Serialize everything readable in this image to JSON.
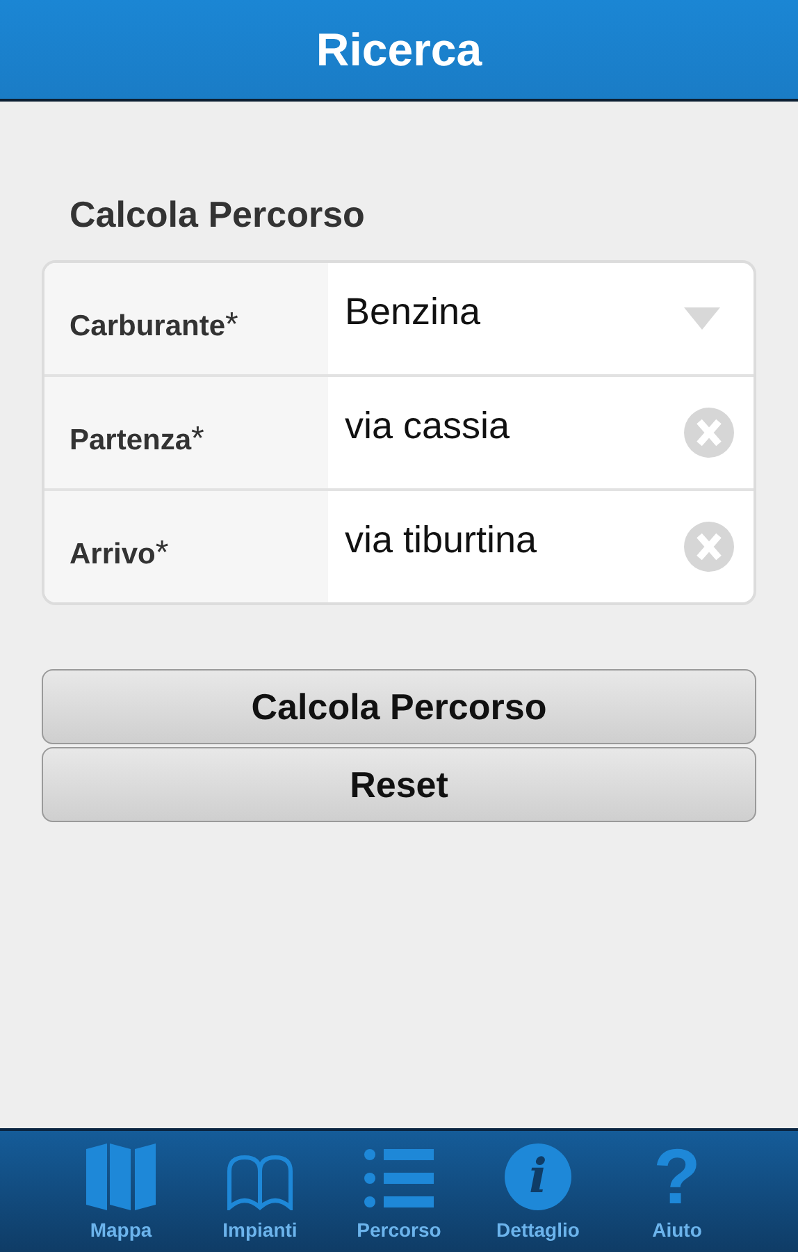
{
  "header": {
    "title": "Ricerca"
  },
  "section_title": "Calcola Percorso",
  "fields": [
    {
      "label": "Carburante",
      "required_mark": "*",
      "kind": "select",
      "value": "Benzina"
    },
    {
      "label": "Partenza",
      "required_mark": "*",
      "kind": "text",
      "value": "via cassia"
    },
    {
      "label": "Arrivo",
      "required_mark": "*",
      "kind": "text",
      "value": "via tiburtina"
    }
  ],
  "buttons": [
    "Calcola Percorso",
    "Reset"
  ],
  "tabs": [
    {
      "label": "Mappa",
      "kind": "map",
      "selected": false
    },
    {
      "label": "Impianti",
      "kind": "book",
      "selected": false
    },
    {
      "label": "Percorso",
      "kind": "list",
      "selected": false
    },
    {
      "label": "Dettaglio",
      "kind": "info",
      "glyph": "i",
      "selected": false
    },
    {
      "label": "Aiuto",
      "kind": "help",
      "glyph": "?",
      "selected": false
    }
  ]
}
